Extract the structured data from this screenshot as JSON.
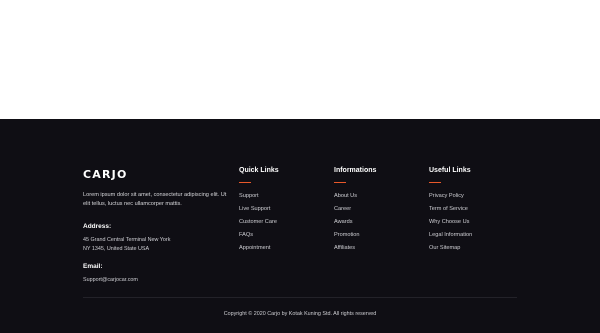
{
  "footer": {
    "brand": "CARJO",
    "description": "Lorem ipsum dolor sit amet, consectetur adipiscing elit. Ut elit tellus, luctus nec ullamcorper mattis.",
    "address_label": "Address:",
    "address_line1": "45 Grand Central Terminal New York",
    "address_line2": "NY 1345, United State USA",
    "email_label": "Email:",
    "email_value": "Support@carjocar.com",
    "columns": [
      {
        "title": "Quick Links",
        "links": [
          "Support",
          "Live Support",
          "Customer Care",
          "FAQs",
          "Appointment"
        ]
      },
      {
        "title": "Informations",
        "links": [
          "About Us",
          "Career",
          "Awards",
          "Promotion",
          "Affiliates"
        ]
      },
      {
        "title": "Useful Links",
        "links": [
          "Privacy Policy",
          "Term of Service",
          "Why Choose Us",
          "Legal Information",
          "Our Sitemap"
        ]
      }
    ],
    "copyright": "Copyright © 2020 Carjo by Kotak Kuning Std. All rights reserved"
  },
  "colors": {
    "footer_bg": "#0f0e14",
    "accent": "#e8582a"
  }
}
